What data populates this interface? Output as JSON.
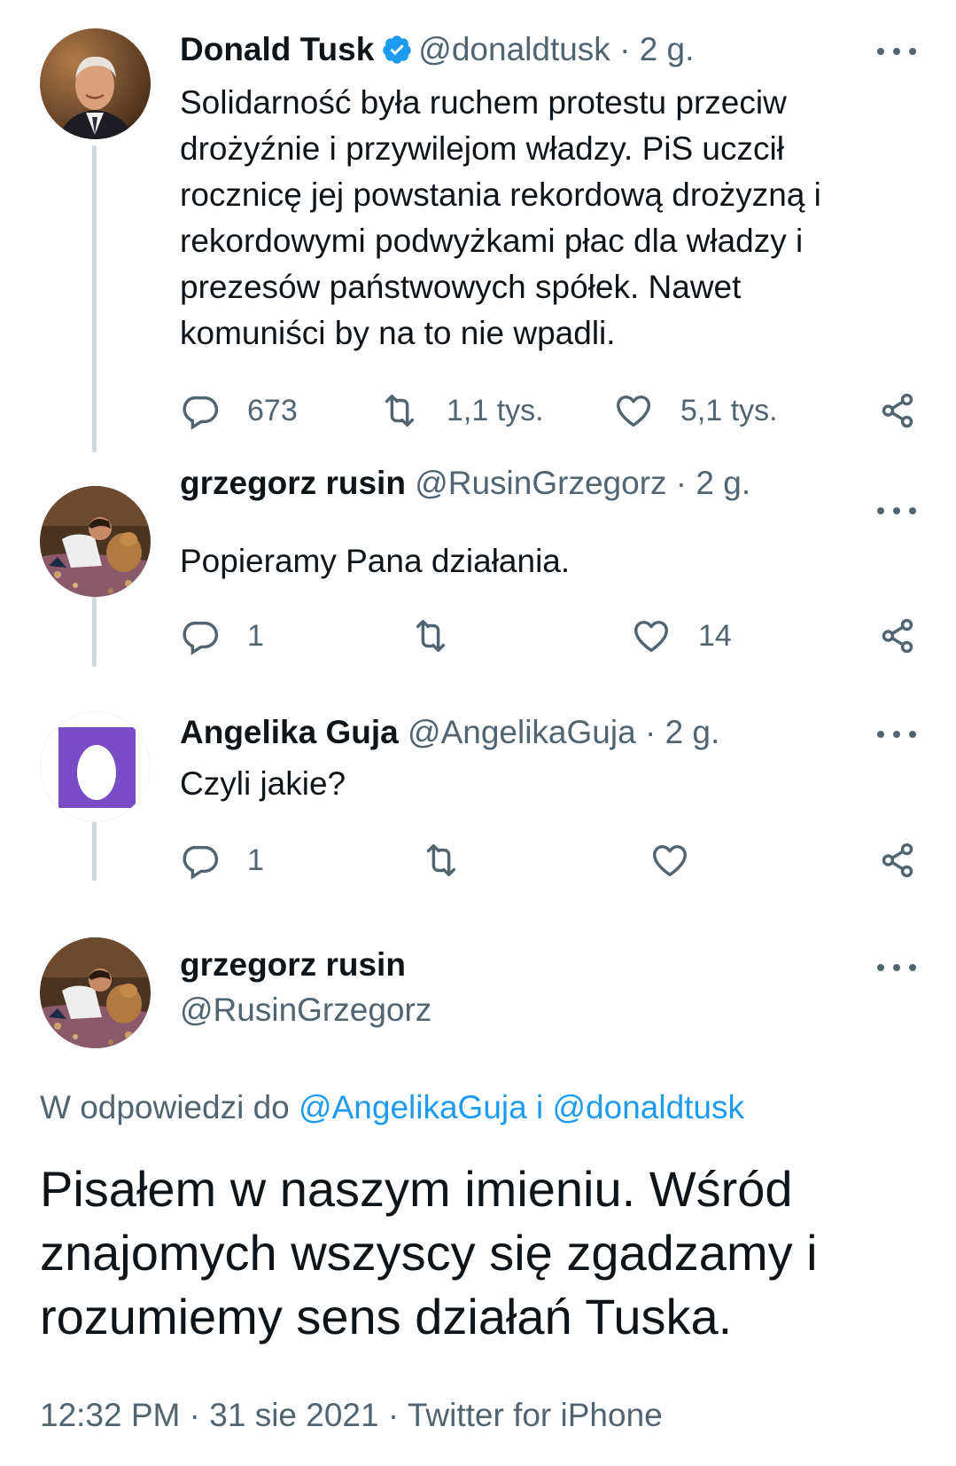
{
  "tweets": [
    {
      "name": "Donald Tusk",
      "handle": "@donaldtusk",
      "separator": "·",
      "time": "2 g.",
      "text": "Solidarność była ruchem protestu przeciw\ndrożyźnie i przywilejom władzy. PiS uczcił\nrocznicę jej powstania rekordową drożyzną i\nrekordowymi podwyżkami płac dla władzy i\nprezesów państwowych spółek. Nawet\nkomuniści by na to nie wpadli.",
      "replies": "673",
      "retweets": "1,1 tys.",
      "likes": "5,1 tys."
    },
    {
      "name": "grzegorz rusin",
      "handle": "@RusinGrzegorz",
      "separator": "·",
      "time": "2 g.",
      "text": "Popieramy Pana działania.",
      "replies": "1",
      "retweets": "",
      "likes": "14"
    },
    {
      "name": "Angelika Guja",
      "handle": "@AngelikaGuja",
      "separator": "·",
      "time": "2 g.",
      "text": "Czyli jakie?",
      "replies": "1",
      "retweets": "",
      "likes": ""
    }
  ],
  "main_tweet": {
    "name": "grzegorz rusin",
    "handle": "@RusinGrzegorz",
    "reply_prefix": "W odpowiedzi do ",
    "reply_user1": "@AngelikaGuja",
    "reply_and": " i ",
    "reply_user2": "@donaldtusk",
    "text": "Pisałem w naszym imieniu. Wśród\nznajomych wszyscy się zgadzamy i\nrozumiemy sens działań Tuska.",
    "time": "12:32 PM",
    "separator": "·",
    "date": "31 sie 2021",
    "source": "Twitter for iPhone"
  },
  "colors": {
    "verified": "#1d9bf0",
    "link": "#1d9bf0",
    "muted": "#536471",
    "egg_avatar": "#794bc4"
  },
  "icons": [
    "verified-badge-icon",
    "more-icon",
    "reply-icon",
    "retweet-icon",
    "like-icon",
    "share-icon"
  ]
}
